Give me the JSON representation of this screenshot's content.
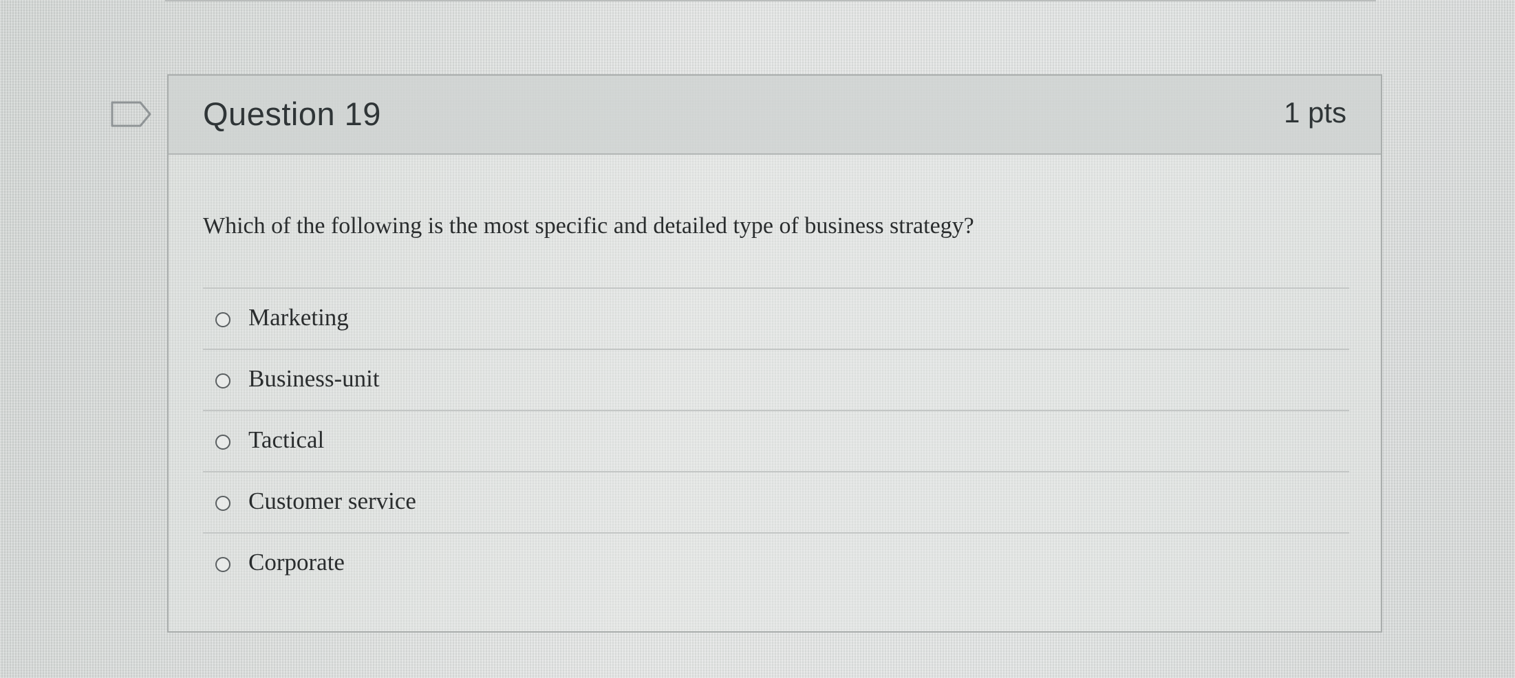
{
  "question": {
    "title": "Question 19",
    "points": "1 pts",
    "text": "Which of the following is the most specific and detailed type of business strategy?",
    "answers": [
      {
        "label": "Marketing"
      },
      {
        "label": "Business-unit"
      },
      {
        "label": "Tactical"
      },
      {
        "label": "Customer service"
      },
      {
        "label": "Corporate"
      }
    ]
  },
  "icons": {
    "flag": "flag-question-icon"
  }
}
